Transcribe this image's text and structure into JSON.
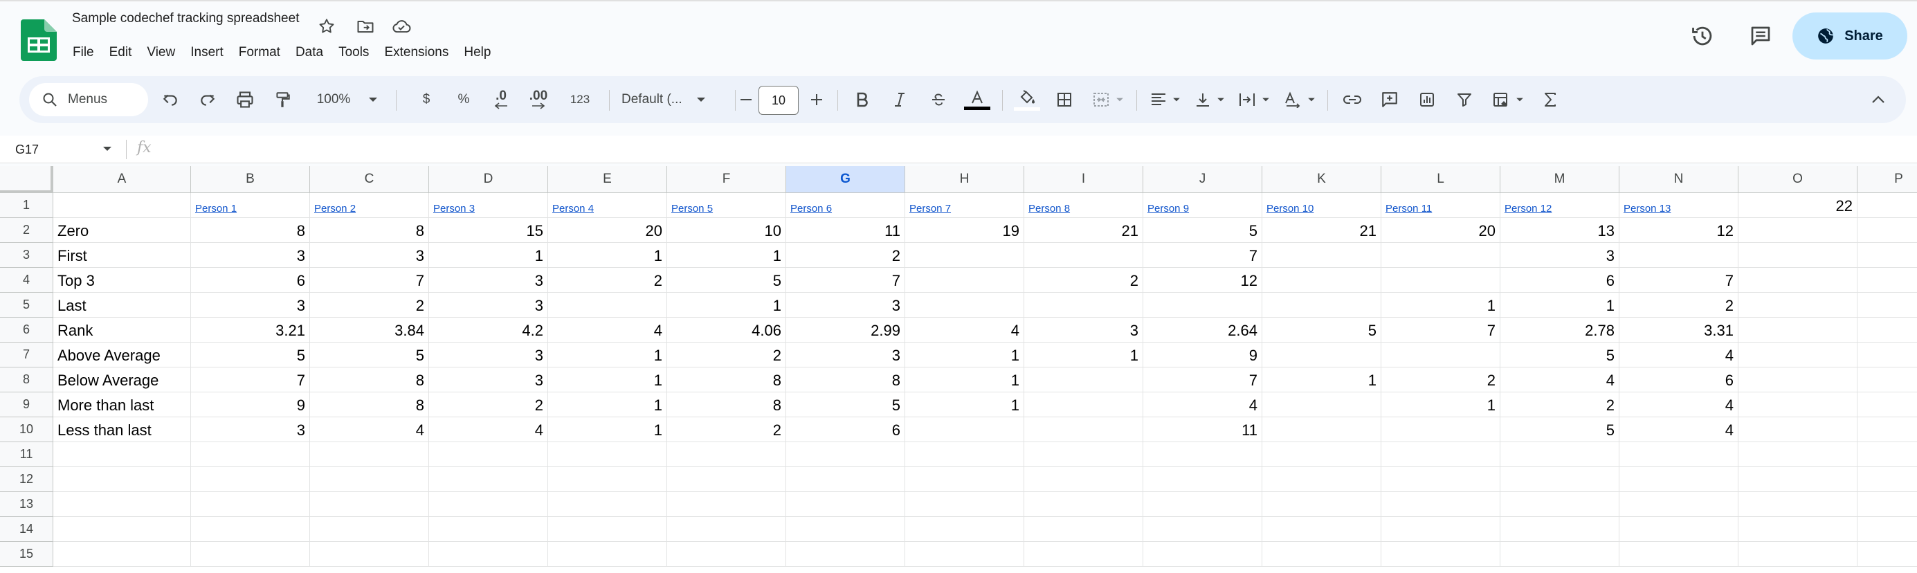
{
  "doc": {
    "title": "Sample codechef tracking spreadsheet"
  },
  "menubar": [
    "File",
    "Edit",
    "View",
    "Insert",
    "Format",
    "Data",
    "Tools",
    "Extensions",
    "Help"
  ],
  "share": {
    "label": "Share"
  },
  "toolbar": {
    "search_placeholder": "Menus",
    "zoom": "100%",
    "currency": "$",
    "percent": "%",
    "decrease_decimal": ".0",
    "increase_decimal": ".00",
    "number_format": "123",
    "font_family": "Default (...",
    "font_size": "10"
  },
  "formula_bar": {
    "cell_ref": "G17",
    "fx": "fx",
    "content": ""
  },
  "colors": {
    "accent": "#0b57d0",
    "share_bg": "#c2e7ff",
    "link": "#1155cc",
    "selected_header": "#d3e3fd",
    "sheets_green": "#0f9d58"
  },
  "sheet": {
    "columns": [
      "A",
      "B",
      "C",
      "D",
      "E",
      "F",
      "G",
      "H",
      "I",
      "J",
      "K",
      "L",
      "M",
      "N",
      "O",
      "P"
    ],
    "selected_column": "G",
    "row_numbers": [
      "1",
      "2",
      "3",
      "4",
      "5",
      "6",
      "7",
      "8",
      "9",
      "10",
      "11",
      "12",
      "13",
      "14",
      "15"
    ],
    "rows": [
      [
        "",
        "Person 1",
        "Person 2",
        "Person 3",
        "Person 4",
        "Person 5",
        "Person 6",
        "Person 7",
        "Person 8",
        "Person 9",
        "Person 10",
        "Person 11",
        "Person 12",
        "Person 13",
        "22",
        ""
      ],
      [
        "Zero",
        "8",
        "8",
        "15",
        "20",
        "10",
        "11",
        "19",
        "21",
        "5",
        "21",
        "20",
        "13",
        "12",
        "",
        ""
      ],
      [
        "First",
        "3",
        "3",
        "1",
        "1",
        "1",
        "2",
        "",
        "",
        "7",
        "",
        "",
        "3",
        "",
        "",
        ""
      ],
      [
        "Top 3",
        "6",
        "7",
        "3",
        "2",
        "5",
        "7",
        "",
        "2",
        "12",
        "",
        "",
        "6",
        "7",
        "",
        ""
      ],
      [
        "Last",
        "3",
        "2",
        "3",
        "",
        "1",
        "3",
        "",
        "",
        "",
        "",
        "1",
        "1",
        "2",
        "",
        ""
      ],
      [
        "Rank",
        "3.21",
        "3.84",
        "4.2",
        "4",
        "4.06",
        "2.99",
        "4",
        "3",
        "2.64",
        "5",
        "7",
        "2.78",
        "3.31",
        "",
        ""
      ],
      [
        "Above Average",
        "5",
        "5",
        "3",
        "1",
        "2",
        "3",
        "1",
        "1",
        "9",
        "",
        "",
        "5",
        "4",
        "",
        ""
      ],
      [
        "Below Average",
        "7",
        "8",
        "3",
        "1",
        "8",
        "8",
        "1",
        "",
        "7",
        "1",
        "2",
        "4",
        "6",
        "",
        ""
      ],
      [
        "More than last",
        "9",
        "8",
        "2",
        "1",
        "8",
        "5",
        "1",
        "",
        "4",
        "",
        "1",
        "2",
        "4",
        "",
        ""
      ],
      [
        "Less than last",
        "3",
        "4",
        "4",
        "1",
        "2",
        "6",
        "",
        "",
        "11",
        "",
        "",
        "5",
        "4",
        "",
        ""
      ],
      [
        "",
        "",
        "",
        "",
        "",
        "",
        "",
        "",
        "",
        "",
        "",
        "",
        "",
        "",
        "",
        ""
      ],
      [
        "",
        "",
        "",
        "",
        "",
        "",
        "",
        "",
        "",
        "",
        "",
        "",
        "",
        "",
        "",
        ""
      ],
      [
        "",
        "",
        "",
        "",
        "",
        "",
        "",
        "",
        "",
        "",
        "",
        "",
        "",
        "",
        "",
        ""
      ],
      [
        "",
        "",
        "",
        "",
        "",
        "",
        "",
        "",
        "",
        "",
        "",
        "",
        "",
        "",
        "",
        ""
      ],
      [
        "",
        "",
        "",
        "",
        "",
        "",
        "",
        "",
        "",
        "",
        "",
        "",
        "",
        "",
        "",
        ""
      ]
    ]
  }
}
